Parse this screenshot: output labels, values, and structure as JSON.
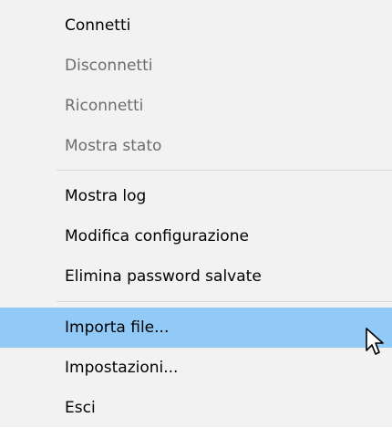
{
  "menu": {
    "items": [
      {
        "label": "Connetti",
        "state": "enabled"
      },
      {
        "label": "Disconnetti",
        "state": "disabled"
      },
      {
        "label": "Riconnetti",
        "state": "disabled"
      },
      {
        "label": "Mostra stato",
        "state": "disabled"
      },
      {
        "label": "Mostra log",
        "state": "enabled"
      },
      {
        "label": "Modifica configurazione",
        "state": "enabled"
      },
      {
        "label": "Elimina password salvate",
        "state": "enabled"
      },
      {
        "label": "Importa file...",
        "state": "hover"
      },
      {
        "label": "Impostazioni...",
        "state": "enabled"
      },
      {
        "label": "Esci",
        "state": "enabled"
      }
    ]
  },
  "colors": {
    "background": "#f2f2f2",
    "hover": "#91c9f7",
    "disabled_text": "#6d6d6d",
    "separator": "#d7d7d7"
  },
  "icons": {
    "cursor": "mouse-pointer-icon"
  }
}
